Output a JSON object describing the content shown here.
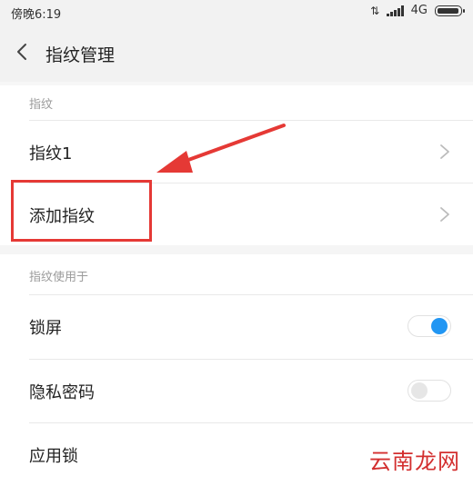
{
  "status_bar": {
    "time": "傍晚6:19",
    "network": "4G",
    "icons": [
      "data-transfer-icon",
      "signal-icon",
      "battery-icon"
    ]
  },
  "header": {
    "title": "指纹管理",
    "back_icon": "chevron-left-icon"
  },
  "sections": [
    {
      "label": "指纹",
      "items": [
        {
          "label": "指纹1",
          "control": "chevron"
        },
        {
          "label": "添加指纹",
          "control": "chevron"
        }
      ]
    },
    {
      "label": "指纹使用于",
      "items": [
        {
          "label": "锁屏",
          "control": "toggle",
          "on": true
        },
        {
          "label": "隐私密码",
          "control": "toggle",
          "on": false
        },
        {
          "label": "应用锁",
          "control": "toggle",
          "on": false
        }
      ]
    }
  ],
  "annotations": {
    "highlight_color": "#e53935",
    "arrow_color": "#e53935"
  },
  "watermark": "云南龙网",
  "colors": {
    "toggle_on": "#2196f3",
    "section_label": "#9a9a9a",
    "header_bg": "#f2f2f2"
  }
}
